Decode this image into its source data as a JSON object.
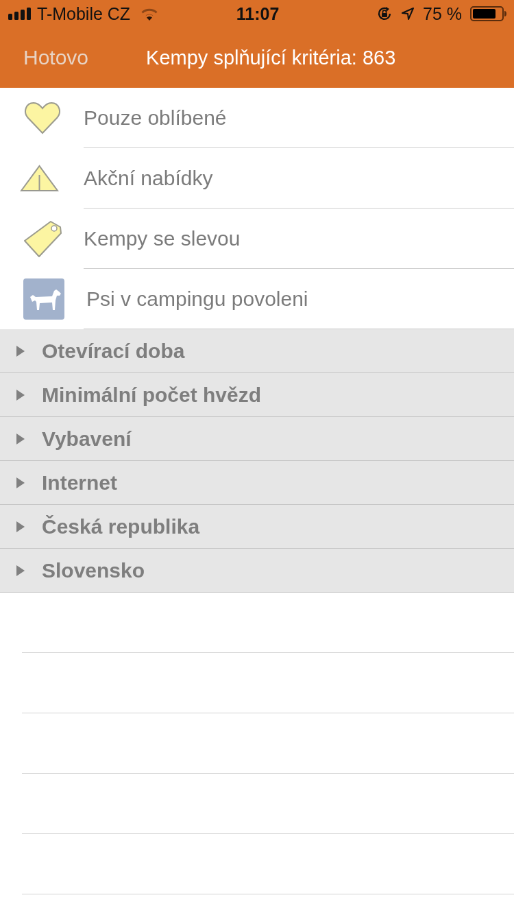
{
  "status_bar": {
    "carrier": "T-Mobile CZ",
    "time": "11:07",
    "battery": "75 %"
  },
  "nav_bar": {
    "done_button": {
      "label": "Hotovo",
      "disabled": true
    },
    "title": "Kempy splňující kritéria: 863"
  },
  "filters": [
    {
      "kind": "favorites",
      "label": "Pouze oblíbené"
    },
    {
      "kind": "offers",
      "label": "Akční nabídky"
    },
    {
      "kind": "discount",
      "label": "Kempy se slevou"
    },
    {
      "kind": "pets",
      "label": "Psi v campingu povoleni"
    }
  ],
  "sections": [
    {
      "label": "Otevírací doba",
      "expanded": false
    },
    {
      "label": "Minimální počet hvězd",
      "expanded": false
    },
    {
      "label": "Vybavení",
      "expanded": false
    },
    {
      "label": "Internet",
      "expanded": false
    },
    {
      "label": "Česká republika",
      "expanded": false
    },
    {
      "label": "Slovensko",
      "expanded": false
    }
  ]
}
